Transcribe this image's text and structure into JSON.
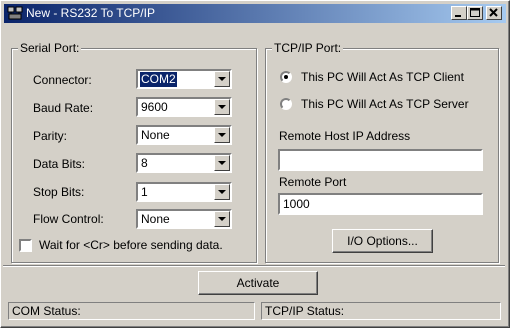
{
  "window": {
    "title": "New - RS232 To TCP/IP",
    "minimize_label": "_",
    "maximize_label": "□",
    "close_label": "✕"
  },
  "serial": {
    "legend": "Serial Port:",
    "connector_label": "Connector:",
    "connector_value": "COM2",
    "baud_label": "Baud Rate:",
    "baud_value": "9600",
    "parity_label": "Parity:",
    "parity_value": "None",
    "databits_label": "Data Bits:",
    "databits_value": "8",
    "stopbits_label": "Stop Bits:",
    "stopbits_value": "1",
    "flow_label": "Flow Control:",
    "flow_value": "None",
    "wait_label": "Wait for <Cr> before sending data.",
    "wait_checked": false
  },
  "tcp": {
    "legend": "TCP/IP Port:",
    "client_label": "This PC Will Act As TCP Client",
    "client_selected": true,
    "server_label": "This PC Will Act As TCP Server",
    "server_selected": false,
    "remote_ip_label": "Remote Host IP Address",
    "remote_ip_value": "",
    "remote_port_label": "Remote Port",
    "remote_port_value": "1000",
    "io_options_label": "I/O Options..."
  },
  "activate_label": "Activate",
  "status": {
    "com": "COM Status:",
    "tcp": "TCP/IP Status:"
  }
}
